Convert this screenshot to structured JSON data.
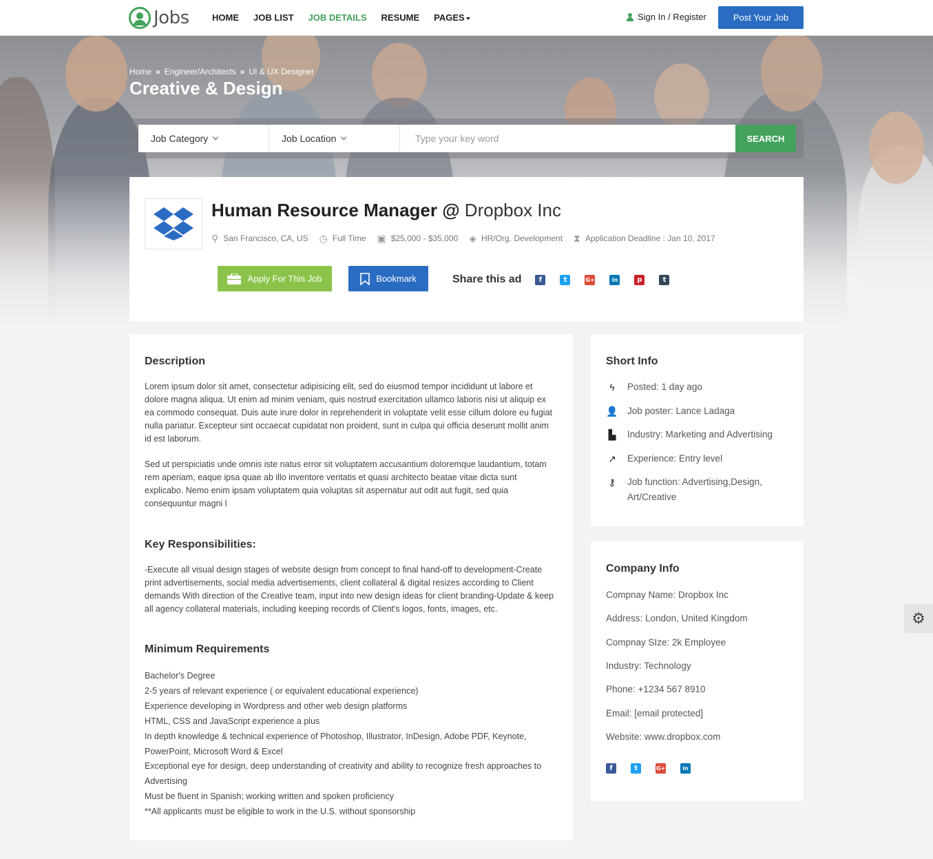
{
  "header": {
    "logo_text": "Jobs",
    "nav": [
      "HOME",
      "JOB LIST",
      "JOB DETAILS",
      "RESUME",
      "PAGES"
    ],
    "active_nav": "JOB DETAILS",
    "signin": "Sign In / Register",
    "post_job": "Post Your Job"
  },
  "hero": {
    "breadcrumb": [
      "Home",
      "Engineer/Architects",
      "UI & UX Designer"
    ],
    "title": "Creative & Design"
  },
  "search": {
    "category": "Job Category",
    "location": "Job Location",
    "placeholder": "Type your key word",
    "button": "SEARCH"
  },
  "job": {
    "title": "Human Resource Manager @",
    "company": "Dropbox Inc",
    "location": "San Francisco, CA, US",
    "type": "Full Time",
    "salary": "$25,000 - $35,000",
    "category": "HR/Org. Development",
    "deadline": "Application Deadline : Jan 10, 2017",
    "apply": "Apply For This Job",
    "bookmark": "Bookmark",
    "share_label": "Share this ad"
  },
  "social_icons": [
    "facebook-icon",
    "twitter-icon",
    "google-plus-icon",
    "linkedin-icon",
    "pinterest-icon",
    "tumblr-icon"
  ],
  "colors": {
    "accent": "#43a25b",
    "primary": "#2a6cc2",
    "apply": "#8bc34a"
  },
  "description": {
    "title": "Description",
    "p1": "Lorem ipsum dolor sit amet, consectetur adipisicing elit, sed do eiusmod tempor incididunt ut labore et dolore magna aliqua. Ut enim ad minim veniam, quis nostrud exercitation ullamco laboris nisi ut aliquip ex ea commodo consequat. Duis aute irure dolor in reprehenderit in voluptate velit esse cillum dolore eu fugiat nulla pariatur. Excepteur sint occaecat cupidatat non proident, sunt in culpa qui officia deserunt mollit anim id est laborum.",
    "p2": "Sed ut perspiciatis unde omnis iste natus error sit voluptatem accusantium doloremque laudantium, totam rem aperiam, eaque ipsa quae ab illo inventore veritatis et quasi architecto beatae vitae dicta sunt explicabo. Nemo enim ipsam voluptatem quia voluptas sit aspernatur aut odit aut fugit, sed quia consequuntur magni l",
    "resp_title": "Key Responsibilities:",
    "resp": "-Execute all visual design stages of website design from concept to final hand-off to development-Create print advertisements, social media advertisements, client collateral & digital resizes according to Client demands With direction of the Creative team, input into new design ideas for client branding-Update & keep all agency collateral materials, including keeping records of Client's logos, fonts, images, etc.",
    "req_title": "Minimum Requirements",
    "requirements": [
      "Bachelor's Degree",
      "2-5 years of relevant experience ( or equivalent educational experience)",
      "Experience developing in Wordpress and other web design platforms",
      "HTML, CSS and JavaScript experience a plus",
      "In depth knowledge & technical experience of Photoshop, Illustrator, InDesign, Adobe PDF, Keynote, PowerPoint, Microsoft Word & Excel",
      "Exceptional eye for design, deep understanding of creativity and ability to recognize fresh approaches to Advertising",
      "Must be fluent in Spanish; working written and spoken proficiency",
      "**All applicants must be eligible to work in the U.S. without sponsorship"
    ]
  },
  "short_info": {
    "title": "Short Info",
    "items": [
      {
        "icon": "bolt-icon",
        "text": "Posted: 1 day ago"
      },
      {
        "icon": "user-plus-icon",
        "text": "Job poster: Lance Ladaga"
      },
      {
        "icon": "industry-icon",
        "text": "Industry: Marketing and Advertising"
      },
      {
        "icon": "line-chart-icon",
        "text": "Experience: Entry level"
      },
      {
        "icon": "key-icon",
        "text": "Job function: Advertising,Design, Art/Creative"
      }
    ]
  },
  "company_info": {
    "title": "Company Info",
    "rows": [
      "Compnay Name: Dropbox Inc",
      "Address: London, United Kingdom",
      "Compnay SIze: 2k Employee",
      "Industry: Technology",
      "Phone: +1234 567 8910",
      "Email: [email protected]",
      "Website: www.dropbox.com"
    ]
  }
}
